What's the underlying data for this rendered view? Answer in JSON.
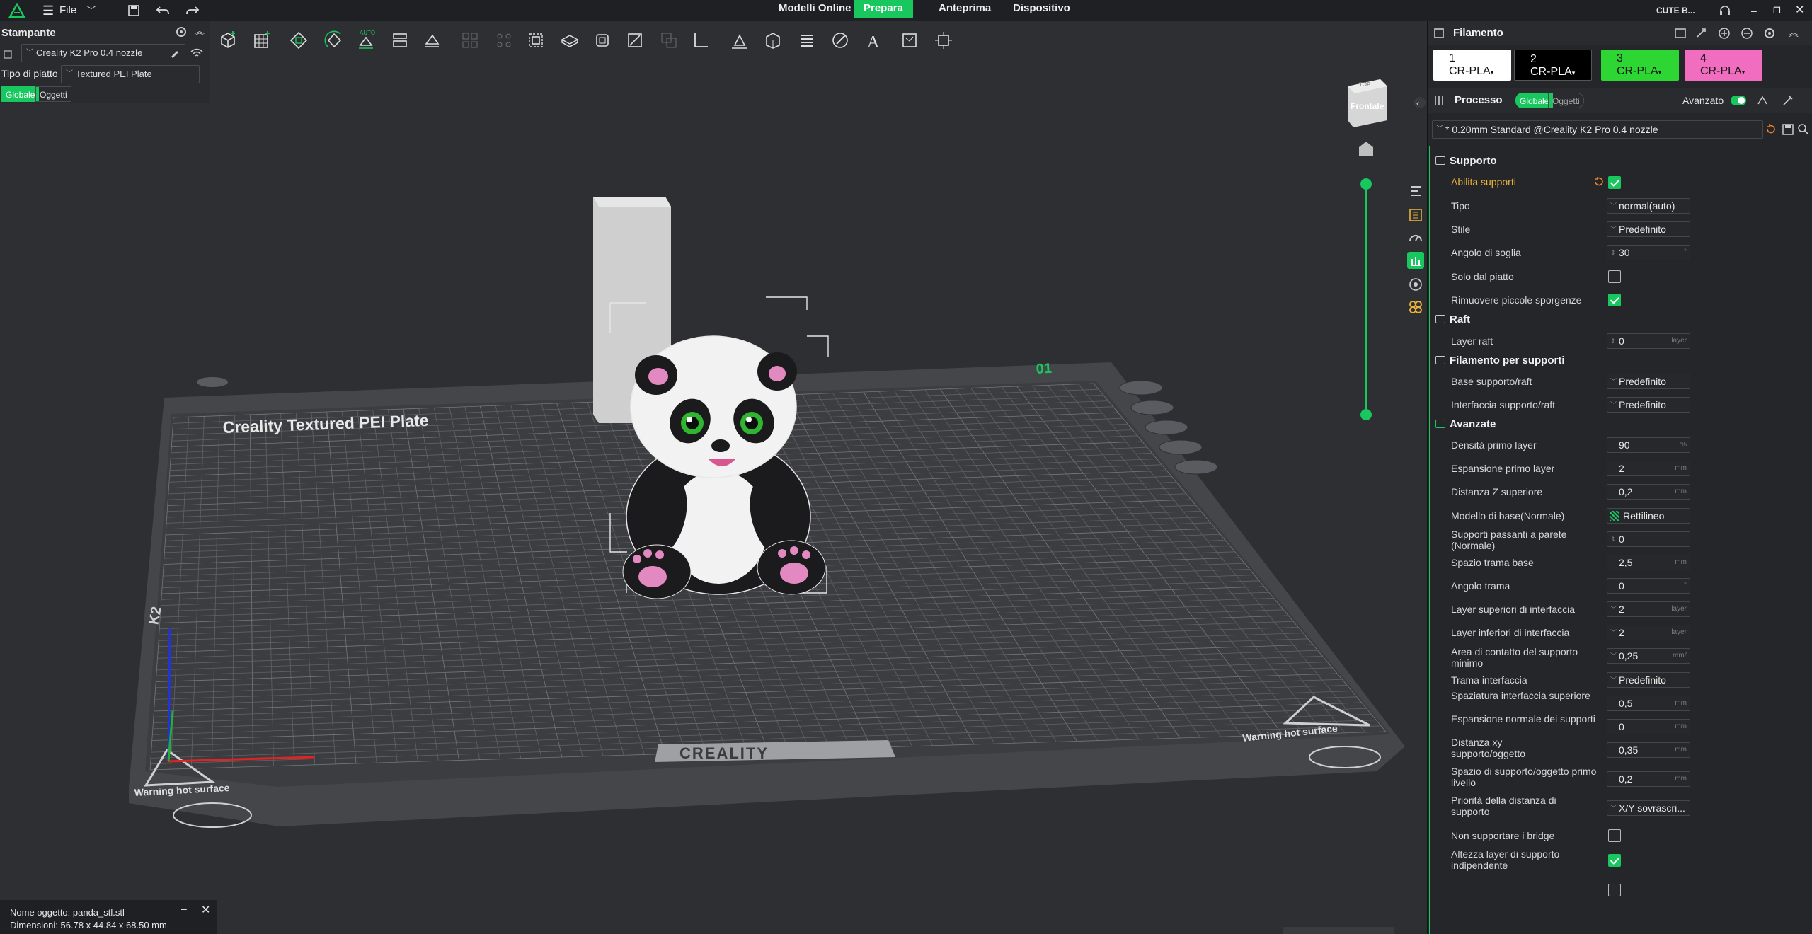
{
  "topbar": {
    "file_label": "File",
    "tabs": [
      "Modelli Online",
      "Prepara",
      "Anteprima",
      "Dispositivo"
    ],
    "active_tab": "Prepara",
    "user_label": "CUTE B..."
  },
  "printer": {
    "section_title": "Stampante",
    "printer_name": "Creality K2 Pro 0.4 nozzle",
    "plate_type_label": "Tipo di piatto",
    "plate_type_value": "Textured PEI Plate",
    "scope_global": "Globale",
    "scope_objects": "Oggetti"
  },
  "viewport": {
    "view_cube_label": "Frontale",
    "view_cube_top": "TOP",
    "plate_title": "Creality Textured PEI Plate",
    "plate_number": "01",
    "bed_brand": "CREALITY",
    "warning_left": "Warning hot surface",
    "warning_right": "Warning hot surface",
    "bed_model": "K2",
    "toolbar_auto": "AUTO"
  },
  "object_info": {
    "name_line": "Nome oggetto: panda_stl.stl",
    "dims_line": "Dimensioni: 56.78 x 44.84 x 68.50 mm"
  },
  "filament": {
    "title": "Filamento",
    "slots": [
      {
        "num": "1",
        "name": "CR-PLA",
        "color": "#ffffff",
        "text": "#111111"
      },
      {
        "num": "2",
        "name": "CR-PLA",
        "color": "#000000",
        "text": "#ffffff"
      },
      {
        "num": "3",
        "name": "CR-PLA",
        "color": "#2ed633",
        "text": "#111111"
      },
      {
        "num": "4",
        "name": "CR-PLA",
        "color": "#f06dbf",
        "text": "#111111"
      }
    ]
  },
  "process": {
    "title": "Processo",
    "scope_global": "Globale",
    "scope_objects": "Oggetti",
    "advanced_label": "Avanzato",
    "preset": "* 0.20mm Standard @Creality K2 Pro 0.4 nozzle"
  },
  "settings": {
    "supporto": "Supporto",
    "abilita_supporti": "Abilita supporti",
    "tipo": "Tipo",
    "tipo_val": "normal(auto)",
    "stile": "Stile",
    "stile_val": "Predefinito",
    "angolo_soglia": "Angolo di soglia",
    "angolo_soglia_val": "30",
    "solo_piatto": "Solo dal piatto",
    "rimuovere": "Rimuovere piccole sporgenze",
    "raft": "Raft",
    "layer_raft": "Layer raft",
    "layer_raft_val": "0",
    "filamento_supporti": "Filamento per supporti",
    "base_supporto": "Base supporto/raft",
    "base_supporto_val": "Predefinito",
    "interfaccia_supporto": "Interfaccia supporto/raft",
    "interfaccia_supporto_val": "Predefinito",
    "avanzate": "Avanzate",
    "densita": "Densità primo layer",
    "densita_val": "90",
    "espansione": "Espansione primo layer",
    "espansione_val": "2",
    "distanza_z": "Distanza Z superiore",
    "distanza_z_val": "0,2",
    "modello_base": "Modello di base(Normale)",
    "modello_base_val": "Rettilineo",
    "supporti_parete": "Supporti passanti a parete (Normale)",
    "supporti_parete_val": "0",
    "spazio_trama": "Spazio trama base",
    "spazio_trama_val": "2,5",
    "angolo_trama": "Angolo trama",
    "angolo_trama_val": "0",
    "layer_sup_int": "Layer superiori di interfaccia",
    "layer_sup_int_val": "2",
    "layer_inf_int": "Layer inferiori di interfaccia",
    "layer_inf_int_val": "2",
    "area_contatto": "Area di contatto del supporto minimo",
    "area_contatto_val": "0,25",
    "trama_interfaccia": "Trama interfaccia",
    "trama_interfaccia_val": "Predefinito",
    "spaziatura_int": "Spaziatura interfaccia superiore",
    "spaziatura_int_val": "0,5",
    "espansione_normale": "Espansione normale dei supporti",
    "espansione_normale_val": "0",
    "distanza_xy": "Distanza xy supporto/oggetto",
    "distanza_xy_val": "0,35",
    "spazio_primo": "Spazio di supporto/oggetto primo livello",
    "spazio_primo_val": "0,2",
    "priorita": "Priorità della distanza di supporto",
    "priorita_val": "X/Y sovrascri...",
    "non_bridge": "Non supportare i bridge",
    "altezza_layer": "Altezza layer di supporto indipendente"
  },
  "units": {
    "pct": "%",
    "mm": "mm",
    "layer": "layer",
    "deg": "°",
    "mm2": "mm²"
  },
  "colors": {
    "accent": "#18c75e",
    "warning": "#e8b13a",
    "panel": "#252629",
    "viewport": "#2e2f33"
  }
}
